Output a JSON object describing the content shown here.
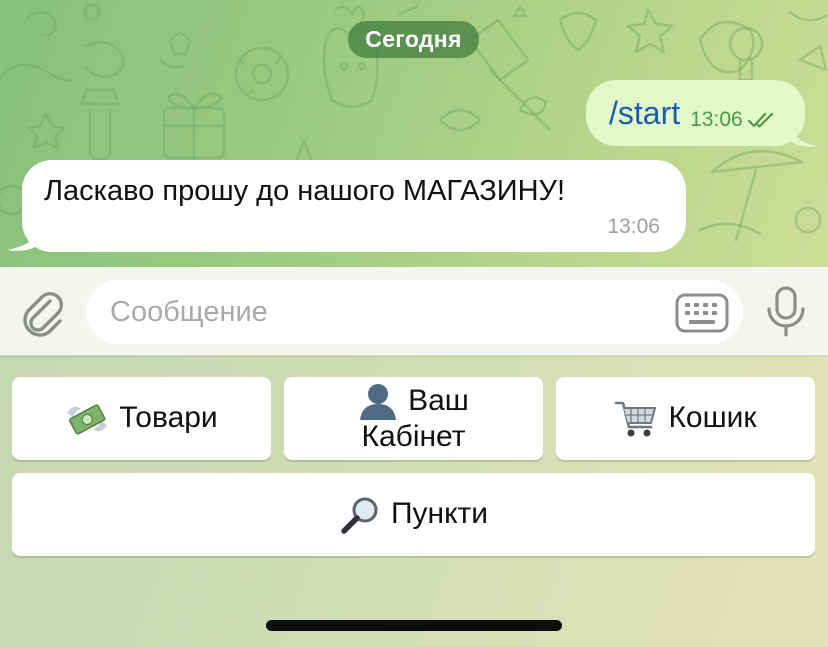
{
  "chat": {
    "date_label": "Сегодня",
    "messages": [
      {
        "direction": "outgoing",
        "text": "/start",
        "time": "13:06",
        "status": "read"
      },
      {
        "direction": "incoming",
        "text": "Ласкаво прошу до нашого МАГАЗИНУ!",
        "time": "13:06"
      }
    ]
  },
  "input": {
    "placeholder": "Сообщение",
    "value": "",
    "icons": {
      "attach": "paperclip-icon",
      "keyboard": "keyboard-icon",
      "voice": "microphone-icon"
    }
  },
  "reply_keyboard": {
    "buttons": [
      {
        "label": "Товари",
        "icon": "money-with-wings-icon"
      },
      {
        "label": "Ваш Кабінет",
        "line1": "Ваш",
        "line2": "Кабінет",
        "icon": "user-silhouette-icon"
      },
      {
        "label": "Кошик",
        "icon": "shopping-cart-icon"
      },
      {
        "label": "Пункти",
        "icon": "magnifier-icon"
      }
    ]
  },
  "colors": {
    "outgoing_bubble": "#e2f8c9",
    "outgoing_text": "#1a5bb6",
    "read_checks": "#4b9a48",
    "date_pill": "#3e7a3c"
  }
}
